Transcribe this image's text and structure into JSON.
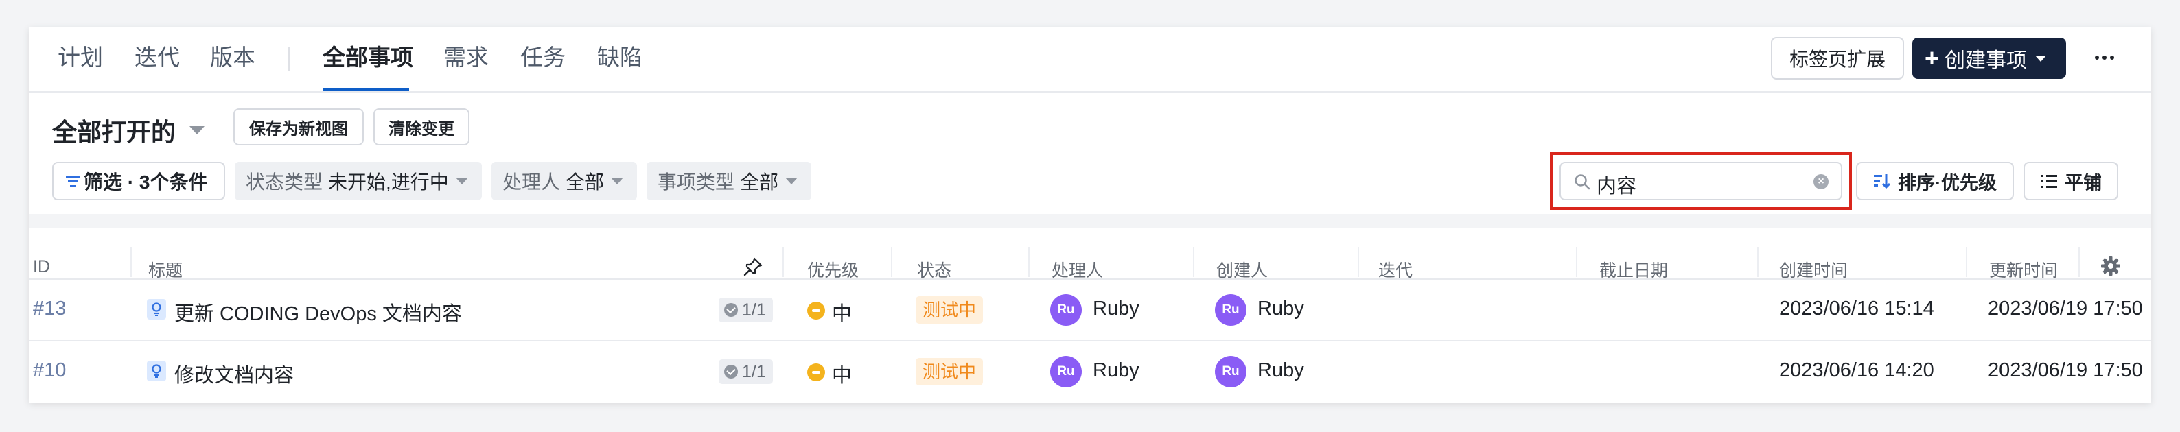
{
  "tabs": [
    {
      "label": "计划"
    },
    {
      "label": "迭代"
    },
    {
      "label": "版本"
    },
    {
      "label": "全部事项"
    },
    {
      "label": "需求"
    },
    {
      "label": "任务"
    },
    {
      "label": "缺陷"
    }
  ],
  "header_actions": {
    "tab_extend_label": "标签页扩展",
    "create_label": "创建事项"
  },
  "view": {
    "name": "全部打开的",
    "save_as_view": "保存为新视图",
    "clear_changes": "清除变更"
  },
  "filters": {
    "filter_label": "筛选 · 3个条件",
    "status": {
      "key": "状态类型",
      "value": "未开始,进行中"
    },
    "assignee": {
      "key": "处理人",
      "value": "全部"
    },
    "issue_type": {
      "key": "事项类型",
      "value": "全部"
    }
  },
  "search": {
    "value": "内容",
    "placeholder": ""
  },
  "sort_label": "排序·优先级",
  "layout_label": "平铺",
  "highlight_color": "#d9261c",
  "table": {
    "columns": [
      "ID",
      "标题",
      "优先级",
      "状态",
      "处理人",
      "创建人",
      "迭代",
      "截止日期",
      "创建时间",
      "更新时间"
    ],
    "rows": [
      {
        "id": "#13",
        "title": "更新 CODING DevOps 文档内容",
        "subtasks": "1/1",
        "priority": "中",
        "status": "测试中",
        "assignee": {
          "initials": "Ru",
          "name": "Ruby"
        },
        "creator": {
          "initials": "Ru",
          "name": "Ruby"
        },
        "iteration": "",
        "due_date": "",
        "created_at": "2023/06/16 15:14",
        "updated_at": "2023/06/19 17:50"
      },
      {
        "id": "#10",
        "title": "修改文档内容",
        "subtasks": "1/1",
        "priority": "中",
        "status": "测试中",
        "assignee": {
          "initials": "Ru",
          "name": "Ruby"
        },
        "creator": {
          "initials": "Ru",
          "name": "Ruby"
        },
        "iteration": "",
        "due_date": "",
        "created_at": "2023/06/16 14:20",
        "updated_at": "2023/06/19 17:50"
      }
    ]
  }
}
